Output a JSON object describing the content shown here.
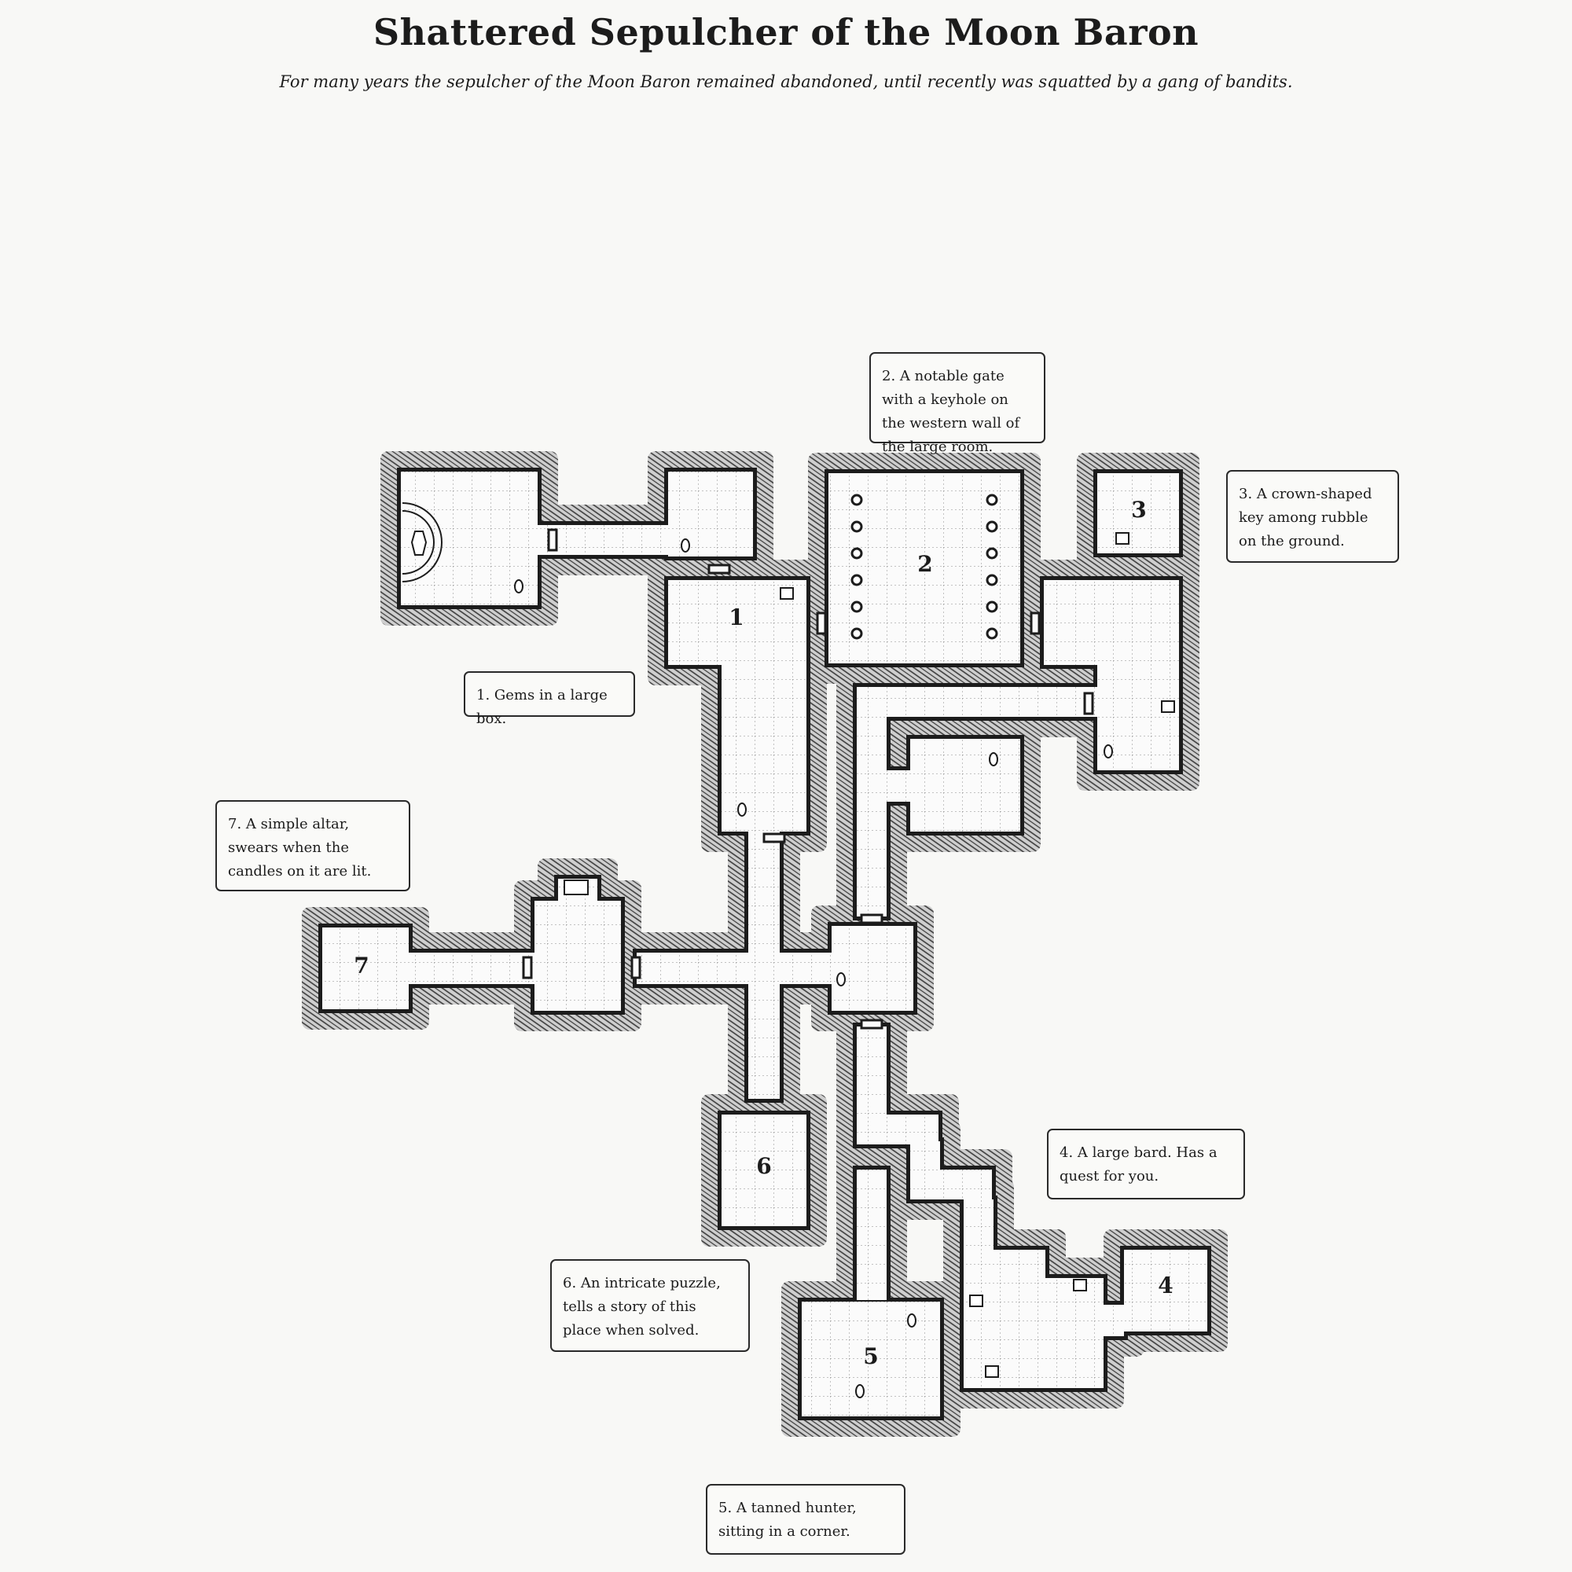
{
  "title": "Shattered Sepulcher of the Moon Baron",
  "subtitle": "For many years the sepulcher of the Moon Baron remained abandoned, until recently was squatted by a gang of bandits.",
  "room_labels": [
    "1",
    "2",
    "3",
    "4",
    "5",
    "6",
    "7"
  ],
  "notes": [
    {
      "key": "note-2",
      "text": "2. A notable gate with a keyhole on the western wall of the large room."
    },
    {
      "key": "note-3",
      "text": "3. A crown-shaped key among rubble on the ground."
    },
    {
      "key": "note-1",
      "text": "1. Gems in a large box."
    },
    {
      "key": "note-7",
      "text": "7. A simple altar, swears when the candles on it are lit."
    },
    {
      "key": "note-4",
      "text": "4. A large bard. Has a quest for you."
    },
    {
      "key": "note-6",
      "text": "6. An intricate puzzle, tells a story of this place when solved."
    },
    {
      "key": "note-5",
      "text": "5. A tanned hunter, sitting in a corner."
    }
  ],
  "colors": {
    "ink": "#1c1c1c",
    "floor": "#fbfbfb",
    "grid": "#8a8a8a",
    "hatch_bg": "#c9c9c9",
    "page": "#f8f8f6"
  }
}
